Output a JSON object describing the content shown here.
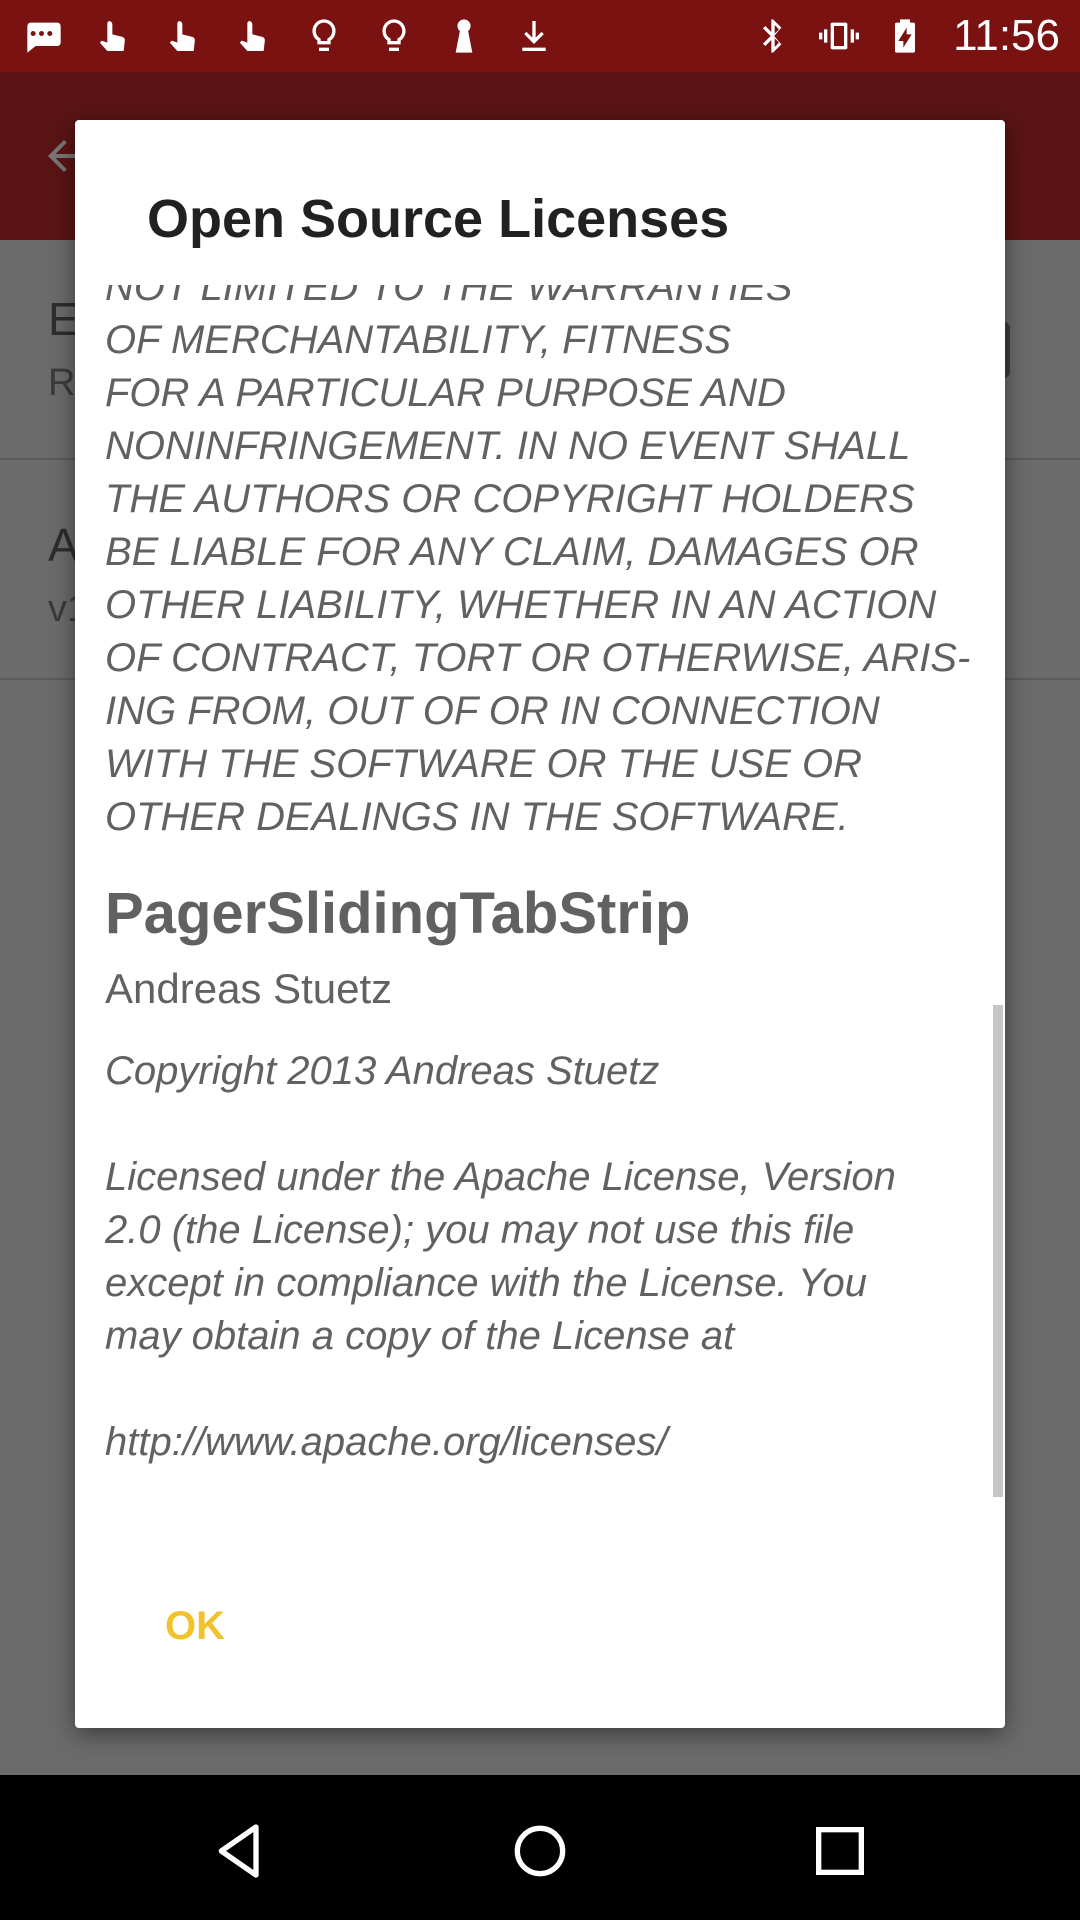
{
  "status_bar": {
    "time": "11:56",
    "left_icons": [
      "message-icon",
      "touch-icon",
      "touch-icon",
      "touch-icon",
      "bulb-icon",
      "bulb-icon",
      "keyhole-icon",
      "download-icon"
    ],
    "right_icons": [
      "bluetooth-icon",
      "vibrate-icon",
      "battery-charging-icon"
    ]
  },
  "background": {
    "row1_title": "E",
    "row1_sub": "R",
    "row2_title": "A",
    "row2_sub": "v1"
  },
  "dialog": {
    "title": "Open Source Licenses",
    "license_top": "WITHOUT WARRANTY OF ANY KIND,\nEXPRESS OR IMPLIED, INCLUDING BUT\nNOT LIMITED TO THE WARRANTIES\nOF MERCHANTABILITY, FITNESS\nFOR A PARTICULAR PURPOSE AND\nNONINFRINGEMENT. IN NO EVENT SHALL\nTHE AUTHORS OR COPYRIGHT HOLDERS\nBE LIABLE FOR ANY CLAIM, DAMAGES OR\nOTHER LIABILITY, WHETHER IN AN ACTION\nOF CONTRACT, TORT OR OTHERWISE, ARIS-\nING FROM, OUT OF OR IN CONNECTION\nWITH THE SOFTWARE OR THE USE OR\nOTHER DEALINGS IN THE SOFTWARE.",
    "library_name": "PagerSlidingTabStrip",
    "library_author": "Andreas Stuetz",
    "license_body": "Copyright 2013 Andreas Stuetz\n\nLicensed under the Apache License, Version\n2.0 (the License); you may not use this file\nexcept in compliance with the License. You\nmay obtain a copy of the License at\n\nhttp://www.apache.org/licenses/",
    "ok_label": "OK"
  },
  "colors": {
    "status_bar": "#7a1212",
    "accent_button": "#f2c12e"
  }
}
